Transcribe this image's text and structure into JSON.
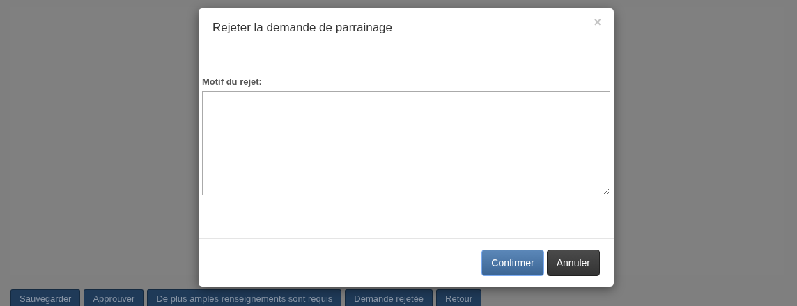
{
  "page": {
    "actions": [
      {
        "label": "Sauvegarder"
      },
      {
        "label": "Approuver"
      },
      {
        "label": "De plus amples renseignements sont requis"
      },
      {
        "label": "Demande rejetée"
      },
      {
        "label": "Retour"
      }
    ]
  },
  "dialog": {
    "title": "Rejeter la demande de parrainage",
    "close": "×",
    "field_label": "Motif du rejet:",
    "buttons": [
      {
        "label": "Confirmer",
        "kind": "primary"
      },
      {
        "label": "Annuler",
        "kind": "secondary"
      }
    ]
  }
}
